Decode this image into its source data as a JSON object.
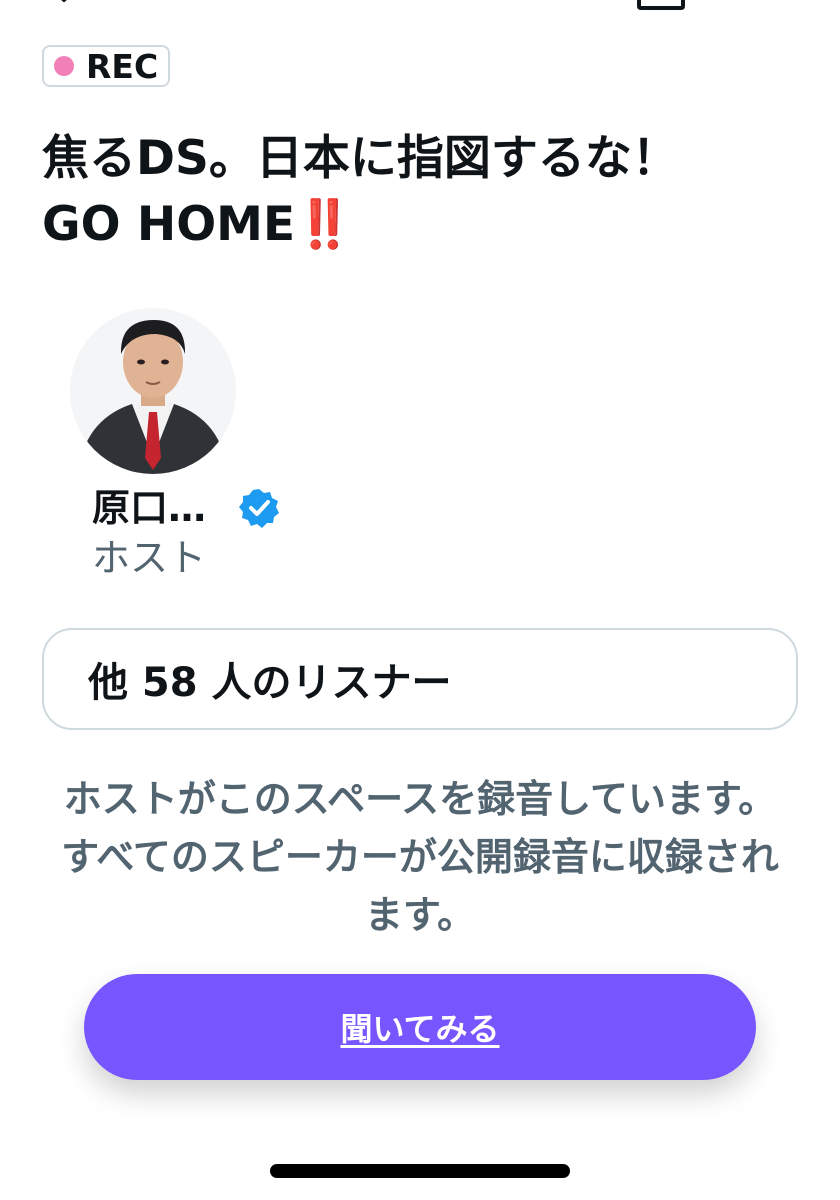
{
  "rec_badge": {
    "label": "REC",
    "dot_color": "#f17fb8"
  },
  "space": {
    "title_line1": "焦るDS。日本に指図するな！",
    "title_line2": "GO HOME",
    "title_emoji": "‼️"
  },
  "host": {
    "name": "原口…",
    "role": "ホスト",
    "verified": true,
    "verified_color": "#1d9bf0",
    "avatar_icon": "host-avatar-photo"
  },
  "listeners": {
    "text": "他 58 人のリスナー"
  },
  "notice": {
    "text": "ホストがこのスペースを録音しています。すべてのスピーカーが公開録音に収録されます。"
  },
  "listen_button": {
    "label": "聞いてみる",
    "color": "#7856ff"
  },
  "icons": {
    "close": "close-icon",
    "share": "share-icon",
    "verified": "verified-badge-icon"
  }
}
